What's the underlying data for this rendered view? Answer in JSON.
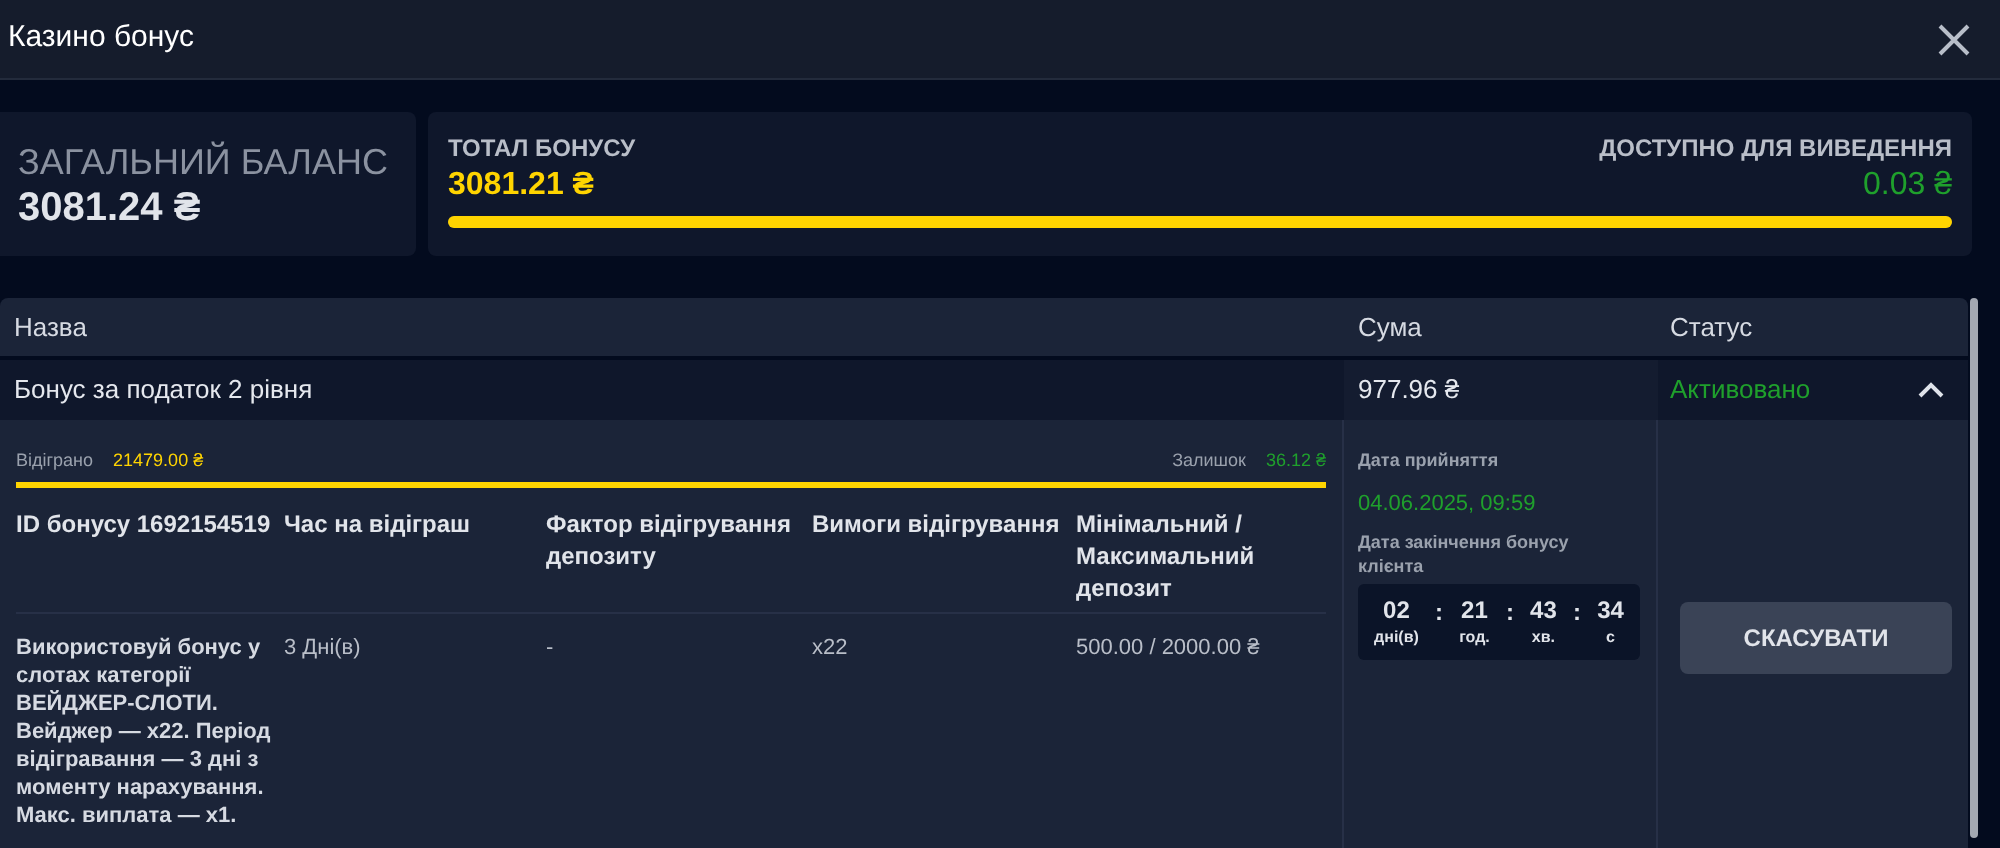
{
  "window": {
    "title": "Казино бонус"
  },
  "balance": {
    "label": "ЗАГАЛЬНИЙ БАЛАНС",
    "amount": "3081.24 ₴"
  },
  "bonus_total": {
    "label": "ТОТАЛ БОНУСУ",
    "amount": "3081.21 ₴",
    "withdraw_label": "ДОСТУПНО ДЛЯ ВИВЕДЕННЯ",
    "withdraw_amount": "0.03 ₴",
    "level": 1
  },
  "table": {
    "columns": [
      "Назва",
      "Сума",
      "Статус"
    ],
    "rows": [
      {
        "name": "Бонус за податок 2 рівня",
        "amount": "977.96 ₴",
        "status": "Активовано",
        "expanded": true,
        "details": {
          "wagered_label": "Відіграно",
          "wagered": "21479.00 ₴",
          "remaining_label": "Залишок",
          "remaining": "36.12 ₴",
          "level": 1,
          "columns": [
            "ID бонусу 1692154519",
            "Час на відіграш",
            "Фактор відігрування депозиту",
            "Вимоги відігрування",
            "Мінімальний / Максимальний депозит"
          ],
          "values": [
            "Використовуй бонус у слотах категорії ВЕЙДЖЕР-СЛОТИ. Вейджер — x22. Період відігравання — 3 дні з моменту нарахування. Макс. виплата — x1.",
            "3 Дні(в)",
            "-",
            "x22",
            "500.00 / 2000.00 ₴"
          ],
          "accepted_label": "Дата прийняття",
          "accepted": "04.06.2025, 09:59",
          "expiry_label": "Дата закінчення бонусу клієнта",
          "countdown": [
            {
              "value": "02",
              "unit": "дні(в)"
            },
            {
              "value": "21",
              "unit": "год."
            },
            {
              "value": "43",
              "unit": "хв."
            },
            {
              "value": "34",
              "unit": "с"
            }
          ],
          "separator": ":",
          "cancel_button": "СКАСУВАТИ"
        }
      }
    ]
  }
}
